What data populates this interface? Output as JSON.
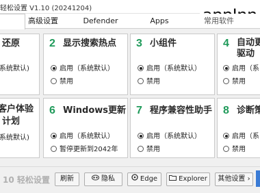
{
  "window": {
    "title": "轻松设置 V1.10  (20241204)",
    "watermark": "appInn"
  },
  "tabs": [
    {
      "label": "",
      "active": true
    },
    {
      "label": "高级设置",
      "active": false
    },
    {
      "label": "Defender",
      "active": false
    },
    {
      "label": "Apps",
      "active": false
    },
    {
      "label": "常用软件",
      "active": false
    }
  ],
  "panels": [
    {
      "num": "",
      "title": "还原",
      "options": [
        {
          "label": "系统默认)",
          "selected": false
        }
      ]
    },
    {
      "num": "2",
      "title": "显示搜索热点",
      "options": [
        {
          "label": "启用（系统默认）",
          "selected": true
        },
        {
          "label": "禁用",
          "selected": false
        }
      ]
    },
    {
      "num": "3",
      "title": "小组件",
      "options": [
        {
          "label": "启用（系统默认）",
          "selected": true
        },
        {
          "label": "禁用",
          "selected": false
        }
      ]
    },
    {
      "num": "4",
      "title": "自动更新驱动",
      "title_line1": "自动更",
      "title_line2": "驱动",
      "options": [
        {
          "label": "启用（系",
          "selected": true
        },
        {
          "label": "禁用",
          "selected": false
        }
      ]
    },
    {
      "num": "",
      "title": "客户体验计划",
      "title_line1": "客户体验",
      "title_line2": "计划",
      "options": [
        {
          "label": "系统默认)",
          "selected": false
        }
      ]
    },
    {
      "num": "6",
      "title": "Windows更新",
      "options": [
        {
          "label": "启用（系统默认）",
          "selected": true
        },
        {
          "label": "暂停更新到2042年",
          "selected": false
        }
      ]
    },
    {
      "num": "7",
      "title": "程序兼容性助手",
      "options": [
        {
          "label": "启用（系统默认）",
          "selected": true
        },
        {
          "label": "禁用",
          "selected": false
        }
      ]
    },
    {
      "num": "8",
      "title": "诊断策略",
      "title_line1": "诊断策",
      "options": [
        {
          "label": "启用（系",
          "selected": true
        },
        {
          "label": "禁用",
          "selected": false
        }
      ]
    }
  ],
  "footer": {
    "brand": "10 轻松设置",
    "buttons": [
      {
        "label": "刷新",
        "icon": ""
      },
      {
        "label": "隐私",
        "icon": "privacy-icon"
      },
      {
        "label": "Edge",
        "icon": "edge-icon"
      },
      {
        "label": "Explorer",
        "icon": "folder-icon"
      },
      {
        "label": "其他设置 ›",
        "icon": ""
      }
    ]
  },
  "colors": {
    "accent_number": "#1f9a5a",
    "panel_border": "#c9c9c9",
    "background": "#f0f0f0"
  }
}
